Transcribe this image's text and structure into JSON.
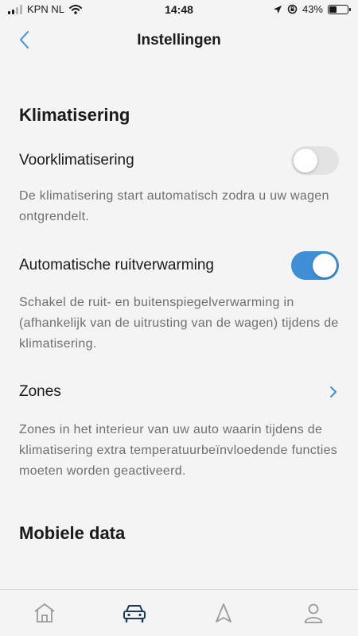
{
  "status_bar": {
    "carrier": "KPN NL",
    "time": "14:48",
    "battery_percent": "43%",
    "battery_level": 0.43,
    "icons": [
      "signal-icon",
      "wifi-icon",
      "location-icon",
      "rotation-lock-icon",
      "battery-icon"
    ]
  },
  "nav": {
    "title": "Instellingen",
    "back_icon": "chevron-left-icon"
  },
  "sections": {
    "climate": {
      "title": "Klimatisering",
      "preclimate": {
        "label": "Voorklimatisering",
        "enabled": false,
        "description": "De klimatisering start automatisch zodra u uw wagen ontgrendelt."
      },
      "window_heating": {
        "label": "Automatische ruitverwarming",
        "enabled": true,
        "description": "Schakel de ruit- en buitenspiegelverwarming in (afhankelijk van de uitrusting van de wagen) tijdens de klimatisering."
      },
      "zones": {
        "label": "Zones",
        "description": "Zones in het interieur van uw auto waarin tijdens de klimatisering extra temperatuurbeïnvloedende functies moeten worden geactiveerd."
      }
    },
    "mobile_data": {
      "title": "Mobiele data"
    }
  },
  "tab_bar": {
    "tabs": [
      "home-icon",
      "car-icon",
      "navigation-icon",
      "profile-icon"
    ],
    "active": "car-icon"
  },
  "colors": {
    "accent": "#3f8ed6",
    "background": "#f4f4f4",
    "text": "#1a1a1a",
    "muted_text": "#6f6f6f"
  }
}
